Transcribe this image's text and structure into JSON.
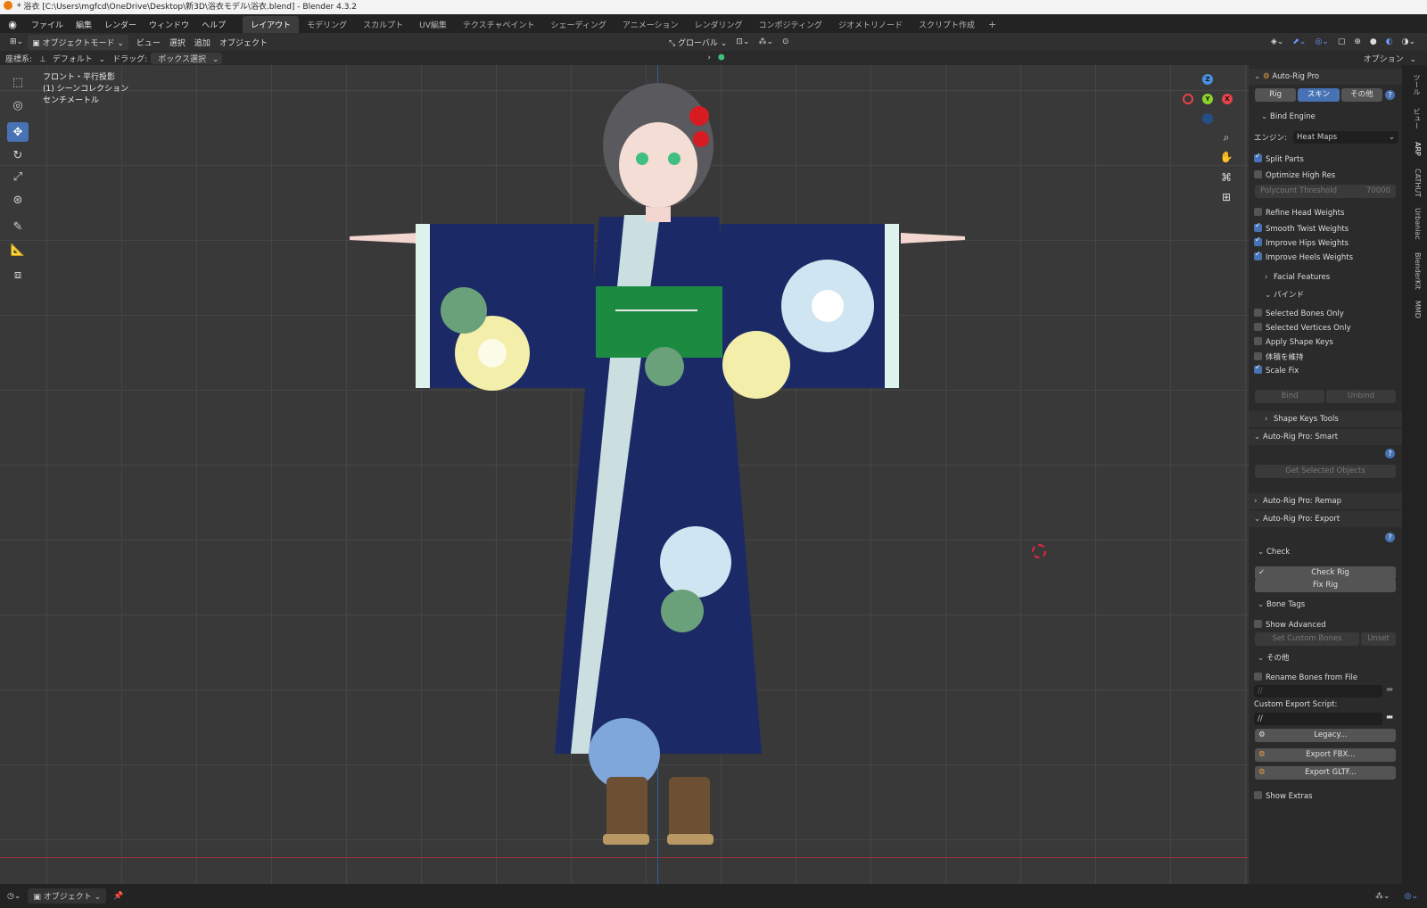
{
  "titlebar": {
    "title": "* 浴衣 [C:\\Users\\mgfcd\\OneDrive\\Desktop\\新3D\\浴衣モデル\\浴衣.blend] - Blender 4.3.2"
  },
  "menus": [
    "ファイル",
    "編集",
    "レンダー",
    "ウィンドウ",
    "ヘルプ"
  ],
  "workspaces": [
    "レイアウト",
    "モデリング",
    "スカルプト",
    "UV編集",
    "テクスチャペイント",
    "シェーディング",
    "アニメーション",
    "レンダリング",
    "コンポジティング",
    "ジオメトリノード",
    "スクリプト作成"
  ],
  "header": {
    "mode": "オブジェクトモード",
    "view": "ビュー",
    "select": "選択",
    "add": "追加",
    "object": "オブジェクト",
    "transform_orientation": "グローバル",
    "options": "オプション"
  },
  "subheader": {
    "coord_label": "座標系:",
    "coord_value": "デフォルト",
    "drag_label": "ドラッグ:",
    "drag_value": "ボックス選択"
  },
  "viewport_info": {
    "line1": "フロント・平行投影",
    "line2": "(1) シーンコレクション",
    "line3": "センチメートル"
  },
  "gizmo": {
    "x": "X",
    "y": "Y",
    "z": "Z"
  },
  "panel": {
    "title": "Auto-Rig Pro",
    "tabs": [
      "Rig",
      "スキン",
      "その他"
    ],
    "active_tab": "スキン",
    "bind_engine": "Bind Engine",
    "engine_label": "エンジン:",
    "engine_value": "Heat Maps",
    "split_parts": "Split Parts",
    "optimize_high_res": "Optimize High Res",
    "polycount_label": "Polycount Threshold",
    "polycount_value": "70000",
    "refine_head": "Refine Head Weights",
    "smooth_twist": "Smooth Twist Weights",
    "improve_hips": "Improve Hips Weights",
    "improve_heels": "Improve Heels Weights",
    "facial_features": "Facial Features",
    "bind_section": "バインド",
    "selected_bones_only": "Selected Bones Only",
    "selected_vertices_only": "Selected Vertices Only",
    "apply_shape_keys": "Apply Shape Keys",
    "keep_volume": "体積を維持",
    "scale_fix": "Scale Fix",
    "bind_btn": "Bind",
    "unbind_btn": "Unbind",
    "shape_keys_tools": "Shape Keys Tools",
    "smart_title": "Auto-Rig Pro: Smart",
    "get_selected_objects": "Get Selected Objects",
    "remap_title": "Auto-Rig Pro: Remap",
    "export_title": "Auto-Rig Pro: Export",
    "check": "Check",
    "check_rig": "Check Rig",
    "fix_rig": "Fix Rig",
    "bone_tags": "Bone Tags",
    "show_advanced": "Show Advanced",
    "set_custom_bones": "Set Custom Bones",
    "unset": "Unset",
    "other_section": "その他",
    "rename_bones": "Rename Bones from File",
    "rename_path": "//",
    "custom_export_label": "Custom Export Script:",
    "custom_export_value": "//",
    "legacy_btn": "Legacy...",
    "export_fbx": "Export FBX...",
    "export_gltf": "Export GLTF...",
    "show_extras": "Show Extras"
  },
  "side_tabs": [
    "ツール",
    "ビュー",
    "ARP",
    "CATHUT",
    "Urbaniac",
    "BlenderKit",
    "MMD"
  ],
  "status": {
    "mode": "オブジェクト"
  }
}
